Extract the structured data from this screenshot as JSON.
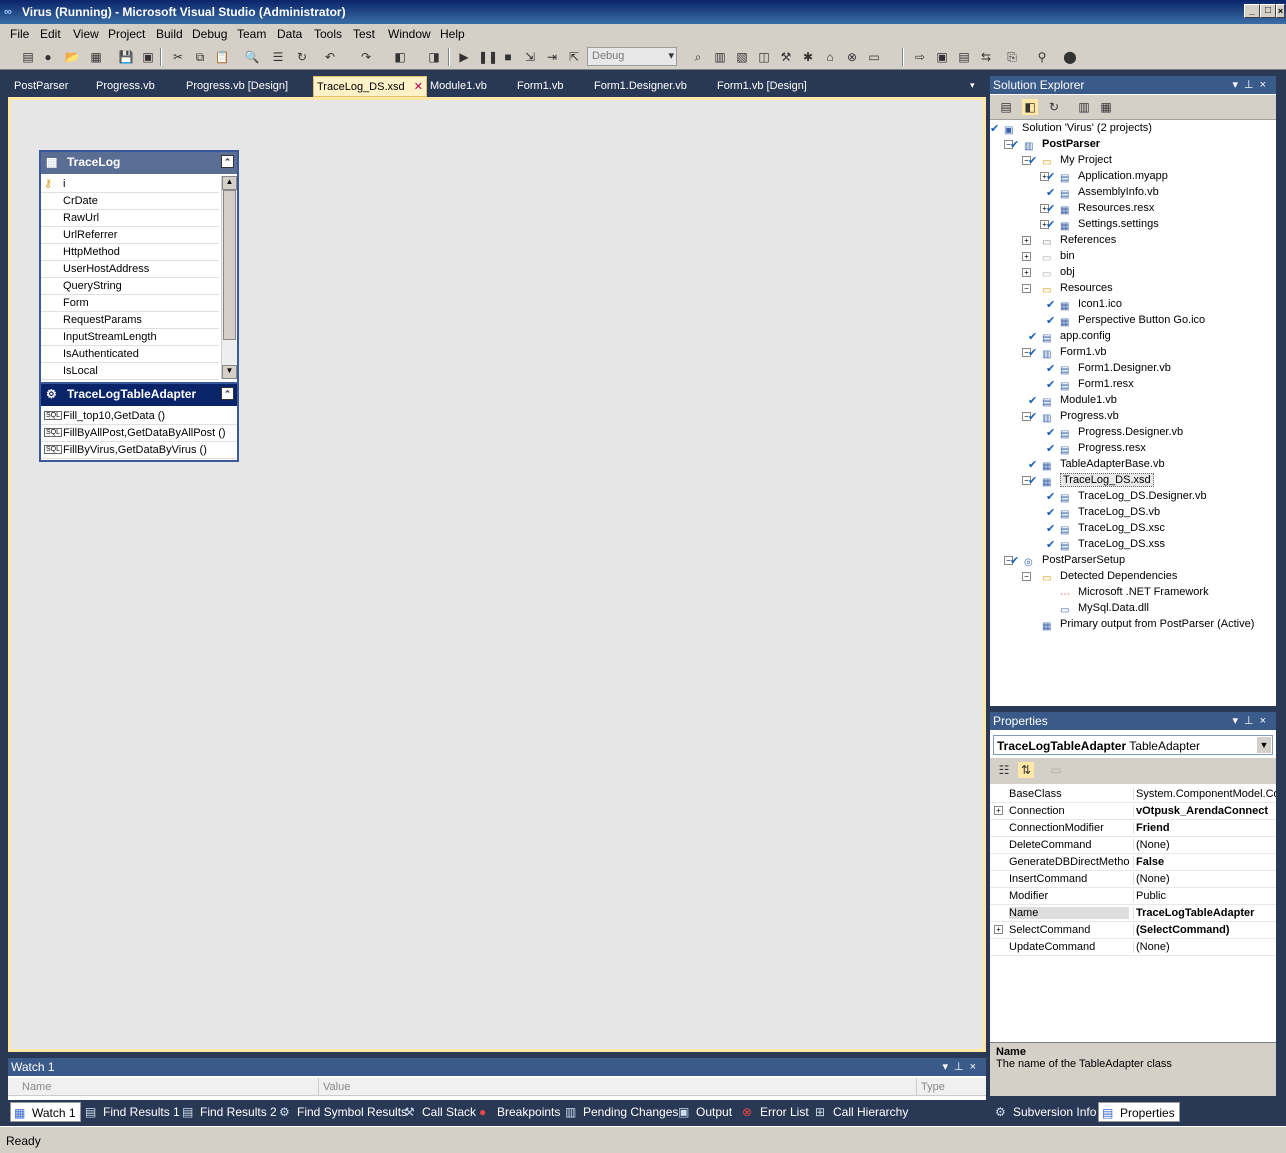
{
  "window": {
    "title": "Virus (Running) - Microsoft Visual Studio (Administrator)",
    "icon": "vs-infinity-icon",
    "controls": [
      "_",
      "□",
      "×"
    ]
  },
  "menu": [
    "File",
    "Edit",
    "View",
    "Project",
    "Build",
    "Debug",
    "Team",
    "Data",
    "Tools",
    "Test",
    "Window",
    "Help"
  ],
  "toolbar": {
    "config": "Debug"
  },
  "doc_tabs": [
    "PostParser",
    "Progress.vb",
    "Progress.vb [Design]",
    "TraceLog_DS.xsd",
    "Module1.vb",
    "Form1.vb",
    "Form1.Designer.vb",
    "Form1.vb [Design]"
  ],
  "active_doc_tab": "TraceLog_DS.xsd",
  "tab_close": "✕",
  "dataset": {
    "table": {
      "name": "TraceLog",
      "columns": [
        "i",
        "CrDate",
        "RawUrl",
        "UrlReferrer",
        "HttpMethod",
        "UserHostAddress",
        "QueryString",
        "Form",
        "RequestParams",
        "InputStreamLength",
        "IsAuthenticated",
        "IsLocal"
      ]
    },
    "adapter": {
      "name": "TraceLogTableAdapter",
      "queries": [
        "Fill_top10,GetData ()",
        "FillByAllPost,GetDataByAllPost ()",
        "FillByVirus,GetDataByVirus ()"
      ]
    },
    "sql_tag": "SQL"
  },
  "watch": {
    "title": "Watch 1",
    "col_name": "Name",
    "col_value": "Value",
    "col_type": "Type"
  },
  "bottom_tabs": [
    "Watch 1",
    "Find Results 1",
    "Find Results 2",
    "Find Symbol Results",
    "Call Stack",
    "Breakpoints",
    "Pending Changes",
    "Output",
    "Error List",
    "Call Hierarchy"
  ],
  "solution_explorer": {
    "title": "Solution Explorer",
    "items": [
      {
        "label": "Solution 'Virus' (2 projects)"
      },
      {
        "label": "PostParser"
      },
      {
        "label": "My Project"
      },
      {
        "label": "Application.myapp"
      },
      {
        "label": "AssemblyInfo.vb"
      },
      {
        "label": "Resources.resx"
      },
      {
        "label": "Settings.settings"
      },
      {
        "label": "References"
      },
      {
        "label": "bin"
      },
      {
        "label": "obj"
      },
      {
        "label": "Resources"
      },
      {
        "label": "Icon1.ico"
      },
      {
        "label": "Perspective Button Go.ico"
      },
      {
        "label": "app.config"
      },
      {
        "label": "Form1.vb"
      },
      {
        "label": "Form1.Designer.vb"
      },
      {
        "label": "Form1.resx"
      },
      {
        "label": "Module1.vb"
      },
      {
        "label": "Progress.vb"
      },
      {
        "label": "Progress.Designer.vb"
      },
      {
        "label": "Progress.resx"
      },
      {
        "label": "TableAdapterBase.vb"
      },
      {
        "label": "TraceLog_DS.xsd"
      },
      {
        "label": "TraceLog_DS.Designer.vb"
      },
      {
        "label": "TraceLog_DS.vb"
      },
      {
        "label": "TraceLog_DS.xsc"
      },
      {
        "label": "TraceLog_DS.xss"
      },
      {
        "label": "PostParserSetup"
      },
      {
        "label": "Detected Dependencies"
      },
      {
        "label": "Microsoft .NET Framework"
      },
      {
        "label": "MySql.Data.dll"
      },
      {
        "label": "Primary output from PostParser (Active)"
      }
    ]
  },
  "properties": {
    "title": "Properties",
    "object_name": "TraceLogTableAdapter",
    "object_type": "TableAdapter",
    "rows": [
      {
        "name": "BaseClass",
        "value": "System.ComponentModel.Com"
      },
      {
        "name": "Connection",
        "value": "vOtpusk_ArendaConnect"
      },
      {
        "name": "ConnectionModifier",
        "value": "Friend"
      },
      {
        "name": "DeleteCommand",
        "value": "(None)"
      },
      {
        "name": "GenerateDBDirectMethods",
        "value": "False"
      },
      {
        "name": "InsertCommand",
        "value": "(None)"
      },
      {
        "name": "Modifier",
        "value": "Public"
      },
      {
        "name": "Name",
        "value": "TraceLogTableAdapter"
      },
      {
        "name": "SelectCommand",
        "value": "(SelectCommand)"
      },
      {
        "name": "UpdateCommand",
        "value": "(None)"
      }
    ],
    "desc_title": "Name",
    "desc_text": "The name of the TableAdapter class"
  },
  "right_tabs": [
    "Subversion Info",
    "Properties"
  ],
  "status": "Ready"
}
